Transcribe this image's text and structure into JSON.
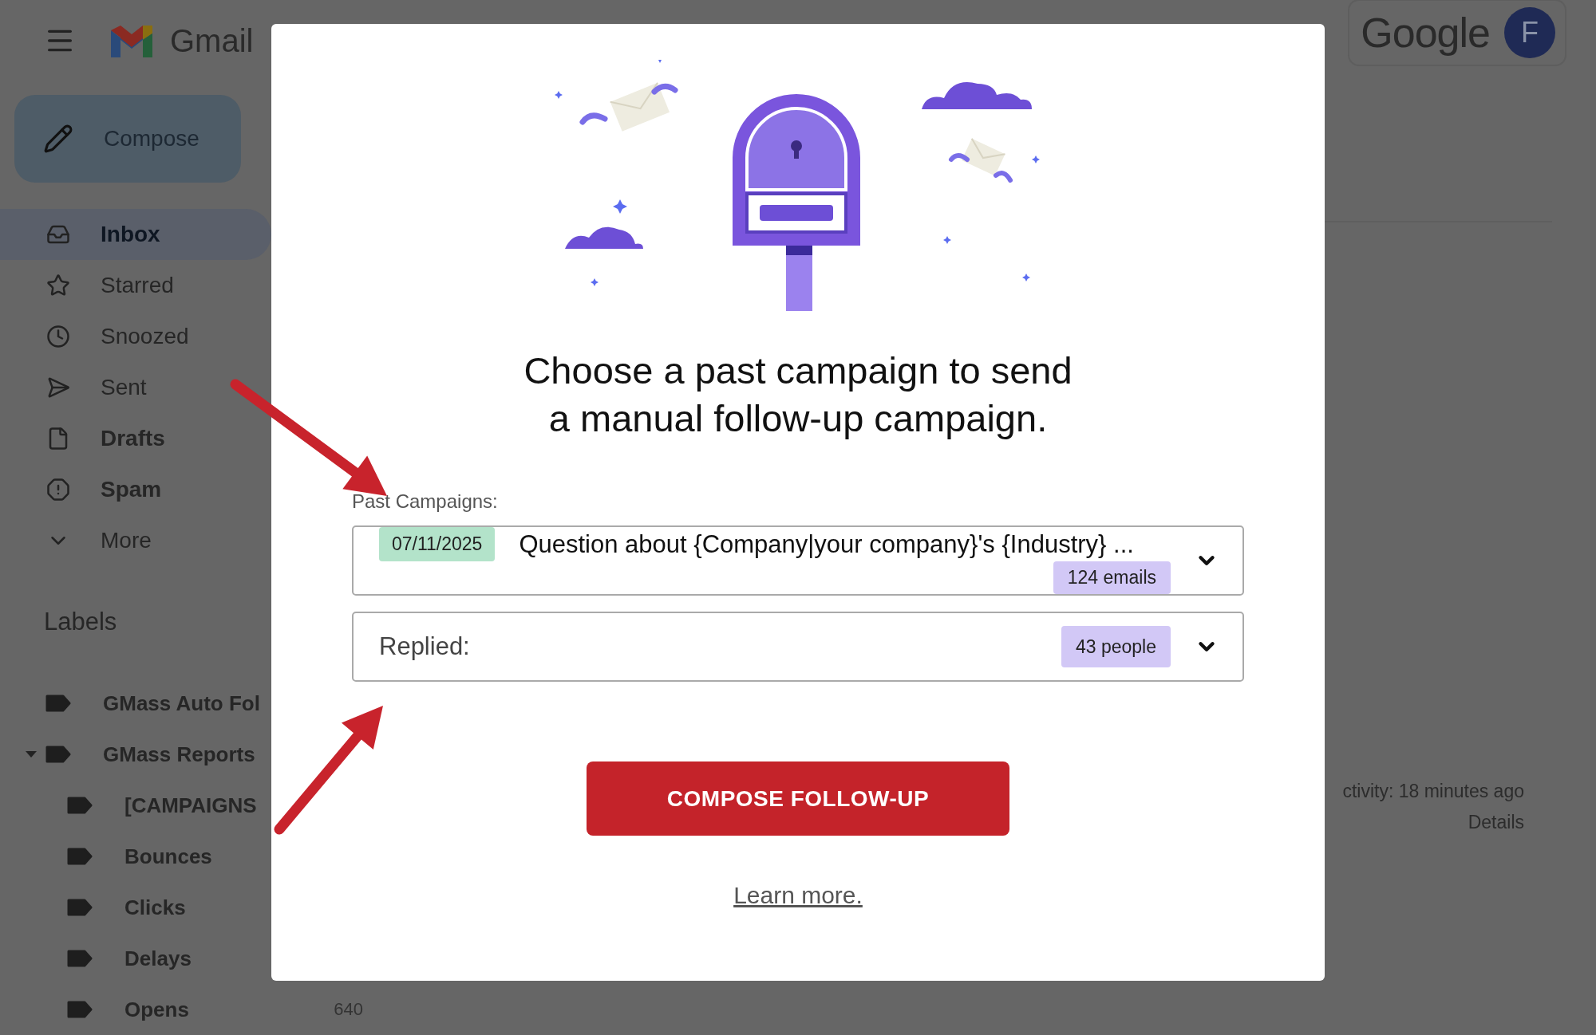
{
  "header": {
    "app_name": "Gmail",
    "account_logo": "Google",
    "avatar_initial": "F"
  },
  "sidebar": {
    "compose_label": "Compose",
    "nav": [
      {
        "label": "Inbox",
        "selected": true,
        "unread": true
      },
      {
        "label": "Starred",
        "selected": false,
        "unread": false
      },
      {
        "label": "Snoozed",
        "selected": false,
        "unread": false
      },
      {
        "label": "Sent",
        "selected": false,
        "unread": false
      },
      {
        "label": "Drafts",
        "selected": false,
        "unread": true
      },
      {
        "label": "Spam",
        "selected": false,
        "unread": true
      },
      {
        "label": "More",
        "selected": false,
        "unread": false
      }
    ],
    "labels_heading": "Labels",
    "labels": [
      {
        "label": "GMass Auto Fol",
        "expanded": false
      },
      {
        "label": "GMass Reports",
        "expanded": true,
        "children": [
          {
            "label": "[CAMPAIGNS"
          },
          {
            "label": "Bounces"
          },
          {
            "label": "Clicks"
          },
          {
            "label": "Delays"
          },
          {
            "label": "Opens",
            "count": "640"
          }
        ]
      }
    ]
  },
  "main": {
    "activity": "ctivity: 18 minutes ago",
    "details": "Details"
  },
  "modal": {
    "heading_lines": [
      "Choose a past campaign to send",
      "a manual follow-up campaign."
    ],
    "campaign_label": "Past Campaigns:",
    "campaign": {
      "date": "07/11/2025",
      "subject": "Question about {Company|your company}'s {Industry} ...",
      "count": "124 emails"
    },
    "filter": {
      "label": "Replied:",
      "count": "43 people"
    },
    "button": "COMPOSE FOLLOW-UP",
    "link": "Learn more."
  }
}
